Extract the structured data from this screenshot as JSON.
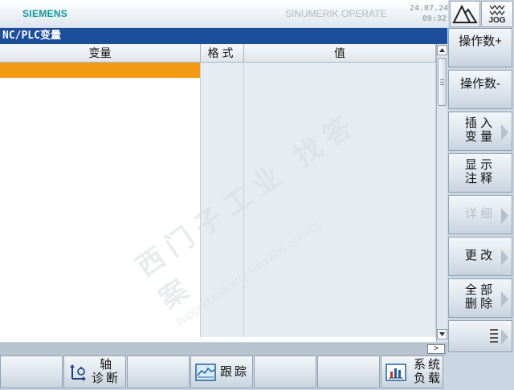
{
  "header": {
    "brand": "SIEMENS",
    "product": "SINUMERIK OPERATE",
    "date": "24.07.24",
    "time": "09:32",
    "mode": "JOG",
    "mode_icon": "jog-wave-icon",
    "area_icon": "area-switch-icon"
  },
  "window": {
    "title": "NC/PLC变量"
  },
  "table": {
    "columns": [
      "变量",
      "格式",
      "值"
    ],
    "row_count": 18,
    "selected_row": 0,
    "rows": [
      [
        "",
        "",
        ""
      ],
      [
        "",
        "",
        ""
      ],
      [
        "",
        "",
        ""
      ],
      [
        "",
        "",
        ""
      ],
      [
        "",
        "",
        ""
      ],
      [
        "",
        "",
        ""
      ],
      [
        "",
        "",
        ""
      ],
      [
        "",
        "",
        ""
      ],
      [
        "",
        "",
        ""
      ],
      [
        "",
        "",
        ""
      ],
      [
        "",
        "",
        ""
      ],
      [
        "",
        "",
        ""
      ],
      [
        "",
        "",
        ""
      ],
      [
        "",
        "",
        ""
      ],
      [
        "",
        "",
        ""
      ],
      [
        "",
        "",
        ""
      ],
      [
        "",
        "",
        ""
      ],
      [
        "",
        "",
        ""
      ]
    ]
  },
  "scroll": {
    "up_icon": "scroll-up-icon",
    "down_icon": "scroll-down-icon",
    "right_icon": "scroll-right-icon",
    "right_glyph": ">"
  },
  "vertical_softkeys": [
    {
      "line1": "操作数+",
      "line2": "",
      "enabled": true,
      "arrow": false
    },
    {
      "line1": "操作数-",
      "line2": "",
      "enabled": true,
      "arrow": false
    },
    {
      "line1": "插 入",
      "line2": "变 量",
      "enabled": true,
      "arrow": true
    },
    {
      "line1": "显 示",
      "line2": "注 释",
      "enabled": true,
      "arrow": false
    },
    {
      "line1": "详 细",
      "line2": "",
      "enabled": false,
      "arrow": true
    },
    {
      "line1": "更 改",
      "line2": "",
      "enabled": true,
      "arrow": true
    },
    {
      "line1": "全 部",
      "line2": "删 除",
      "enabled": true,
      "arrow": true
    },
    {
      "line1": "",
      "line2": "",
      "enabled": true,
      "arrow": true,
      "icon": "menu-list-icon"
    }
  ],
  "horizontal_softkeys": [
    {
      "line1": "",
      "line2": "",
      "icon": ""
    },
    {
      "line1": "轴",
      "line2": "诊断",
      "icon": "axis-diagnosis-icon"
    },
    {
      "line1": "",
      "line2": "",
      "icon": ""
    },
    {
      "line1": "跟踪",
      "line2": "",
      "icon": "trace-icon"
    },
    {
      "line1": "",
      "line2": "",
      "icon": ""
    },
    {
      "line1": "系统",
      "line2": "负载",
      "icon": "system-load-icon"
    },
    {
      "line1": "",
      "line2": "",
      "icon": ""
    }
  ],
  "watermark": {
    "line1": "西门子工业 找答案",
    "line2": "support.industry.siemens.com/cs"
  },
  "colors": {
    "title_bar": "#1c4e9b",
    "selection": "#f29a12",
    "brand": "#0a9a9a"
  }
}
